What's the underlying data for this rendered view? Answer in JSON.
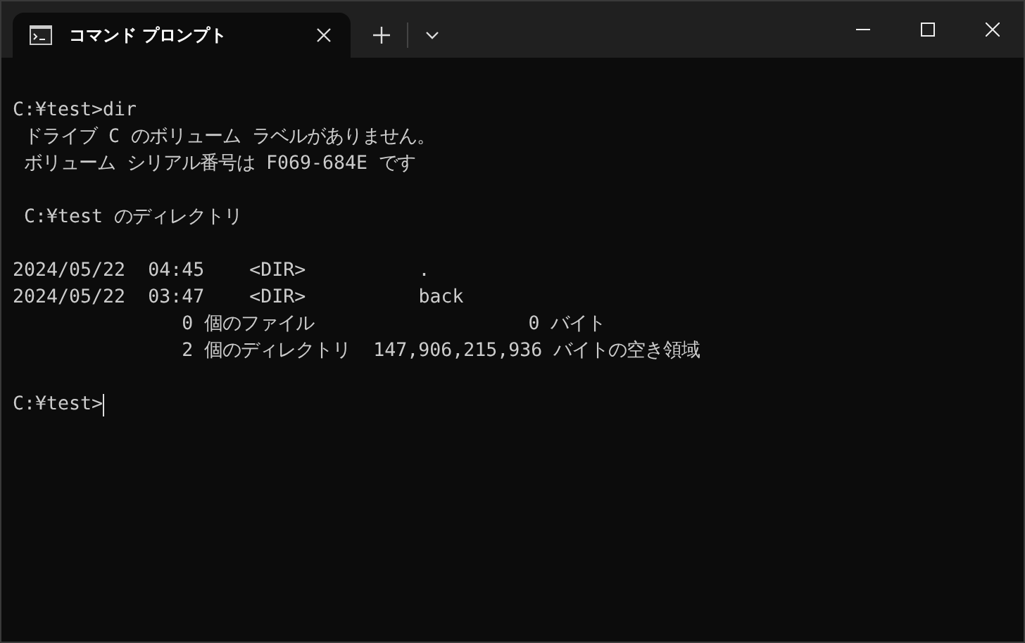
{
  "window": {
    "tab": {
      "title": "コマンド プロンプト",
      "selected": true
    }
  },
  "console": {
    "blocks": [
      [
        "C:¥test>dir",
        " ドライブ C のボリューム ラベルがありません。",
        " ボリューム シリアル番号は F069-684E です"
      ],
      [
        " C:¥test のディレクトリ"
      ],
      [
        "2024/05/22  04:45    <DIR>          .",
        "2024/05/22  03:47    <DIR>          back",
        "               0 個のファイル                   0 バイト",
        "               2 個のディレクトリ  147,906,215,936 バイトの空き領域"
      ],
      [
        "C:¥test>"
      ]
    ],
    "cursor_visible": true
  }
}
